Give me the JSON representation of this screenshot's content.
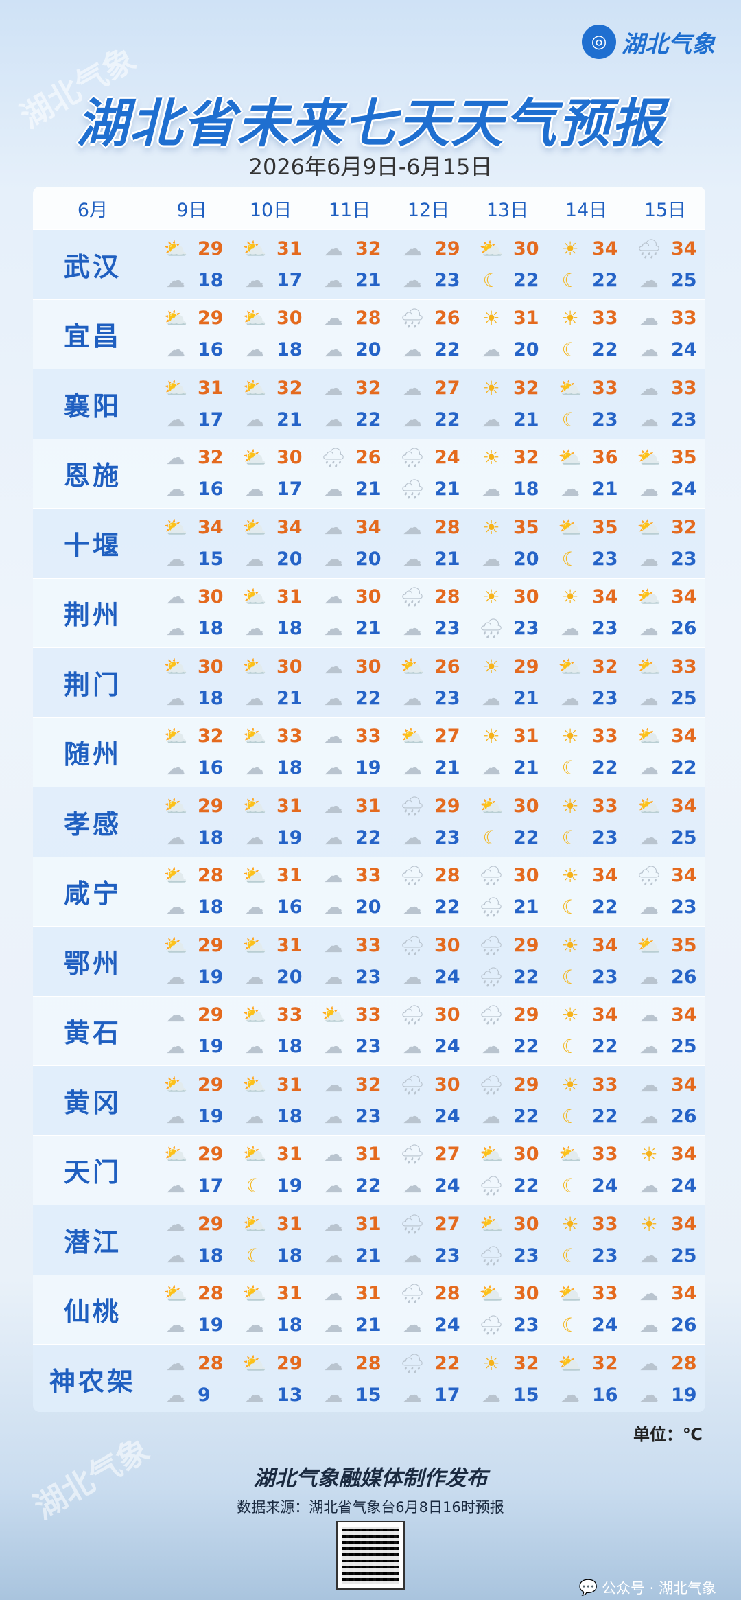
{
  "brand": {
    "name": "湖北气象",
    "logo": "swirl-logo"
  },
  "watermark": "湖北气象",
  "title": "湖北省未来七天天气预报",
  "subtitle": "2026年6月9日-6月15日",
  "table": {
    "month_header": "6月",
    "day_headers": [
      "9日",
      "10日",
      "11日",
      "12日",
      "13日",
      "14日",
      "15日"
    ],
    "rows": [
      {
        "city": "武汉",
        "days": [
          {
            "top": "sun-cloud",
            "hi": "29",
            "bottom": "cloud",
            "lo": "18"
          },
          {
            "top": "sun-cloud",
            "hi": "31",
            "bottom": "moon-cloud",
            "lo": "17"
          },
          {
            "top": "cloud",
            "hi": "32",
            "bottom": "moon-cloud",
            "lo": "21"
          },
          {
            "top": "cloud",
            "hi": "29",
            "bottom": "cloud",
            "lo": "23"
          },
          {
            "top": "sun-cloud",
            "hi": "30",
            "bottom": "moon",
            "lo": "22"
          },
          {
            "top": "sun",
            "hi": "34",
            "bottom": "moon",
            "lo": "22"
          },
          {
            "top": "rain-cloud",
            "hi": "34",
            "bottom": "cloud",
            "lo": "25"
          }
        ]
      },
      {
        "city": "宜昌",
        "days": [
          {
            "top": "sun-cloud",
            "hi": "29",
            "bottom": "moon-cloud",
            "lo": "16"
          },
          {
            "top": "sun-cloud",
            "hi": "30",
            "bottom": "moon-cloud",
            "lo": "18"
          },
          {
            "top": "cloud",
            "hi": "28",
            "bottom": "moon-cloud",
            "lo": "20"
          },
          {
            "top": "rain-cloud",
            "hi": "26",
            "bottom": "cloud",
            "lo": "22"
          },
          {
            "top": "sun",
            "hi": "31",
            "bottom": "moon-cloud",
            "lo": "20"
          },
          {
            "top": "sun",
            "hi": "33",
            "bottom": "moon",
            "lo": "22"
          },
          {
            "top": "cloud",
            "hi": "33",
            "bottom": "moon-cloud",
            "lo": "24"
          }
        ]
      },
      {
        "city": "襄阳",
        "days": [
          {
            "top": "sun-cloud",
            "hi": "31",
            "bottom": "moon-cloud",
            "lo": "17"
          },
          {
            "top": "sun-cloud",
            "hi": "32",
            "bottom": "moon-cloud",
            "lo": "21"
          },
          {
            "top": "cloud",
            "hi": "32",
            "bottom": "moon-cloud",
            "lo": "22"
          },
          {
            "top": "cloud",
            "hi": "27",
            "bottom": "cloud",
            "lo": "22"
          },
          {
            "top": "sun",
            "hi": "32",
            "bottom": "moon-cloud",
            "lo": "21"
          },
          {
            "top": "sun-cloud",
            "hi": "33",
            "bottom": "moon",
            "lo": "23"
          },
          {
            "top": "cloud",
            "hi": "33",
            "bottom": "cloud",
            "lo": "23"
          }
        ]
      },
      {
        "city": "恩施",
        "days": [
          {
            "top": "cloud",
            "hi": "32",
            "bottom": "cloud",
            "lo": "16"
          },
          {
            "top": "sun-cloud",
            "hi": "30",
            "bottom": "moon-cloud",
            "lo": "17"
          },
          {
            "top": "rain-cloud",
            "hi": "26",
            "bottom": "moon-cloud",
            "lo": "21"
          },
          {
            "top": "rain-cloud",
            "hi": "24",
            "bottom": "rain-cloud",
            "lo": "21"
          },
          {
            "top": "sun",
            "hi": "32",
            "bottom": "moon-cloud",
            "lo": "18"
          },
          {
            "top": "sun-cloud",
            "hi": "36",
            "bottom": "moon-cloud",
            "lo": "21"
          },
          {
            "top": "sun-cloud",
            "hi": "35",
            "bottom": "moon-cloud",
            "lo": "24"
          }
        ]
      },
      {
        "city": "十堰",
        "days": [
          {
            "top": "sun-cloud",
            "hi": "34",
            "bottom": "moon-cloud",
            "lo": "15"
          },
          {
            "top": "sun-cloud",
            "hi": "34",
            "bottom": "moon-cloud",
            "lo": "20"
          },
          {
            "top": "cloud",
            "hi": "34",
            "bottom": "moon-cloud",
            "lo": "20"
          },
          {
            "top": "cloud",
            "hi": "28",
            "bottom": "cloud",
            "lo": "21"
          },
          {
            "top": "sun",
            "hi": "35",
            "bottom": "moon-cloud",
            "lo": "20"
          },
          {
            "top": "sun-cloud",
            "hi": "35",
            "bottom": "moon",
            "lo": "23"
          },
          {
            "top": "sun-cloud",
            "hi": "32",
            "bottom": "cloud",
            "lo": "23"
          }
        ]
      },
      {
        "city": "荆州",
        "days": [
          {
            "top": "cloud",
            "hi": "30",
            "bottom": "moon-cloud",
            "lo": "18"
          },
          {
            "top": "sun-cloud",
            "hi": "31",
            "bottom": "moon-cloud",
            "lo": "18"
          },
          {
            "top": "cloud",
            "hi": "30",
            "bottom": "moon-cloud",
            "lo": "21"
          },
          {
            "top": "rain-cloud",
            "hi": "28",
            "bottom": "cloud",
            "lo": "23"
          },
          {
            "top": "sun",
            "hi": "30",
            "bottom": "rain-cloud",
            "lo": "23"
          },
          {
            "top": "sun",
            "hi": "34",
            "bottom": "moon-cloud",
            "lo": "23"
          },
          {
            "top": "sun-cloud",
            "hi": "34",
            "bottom": "moon-cloud",
            "lo": "26"
          }
        ]
      },
      {
        "city": "荆门",
        "days": [
          {
            "top": "sun-cloud",
            "hi": "30",
            "bottom": "moon-cloud",
            "lo": "18"
          },
          {
            "top": "sun-cloud",
            "hi": "30",
            "bottom": "moon-cloud",
            "lo": "21"
          },
          {
            "top": "cloud",
            "hi": "30",
            "bottom": "moon-cloud",
            "lo": "22"
          },
          {
            "top": "sun-cloud",
            "hi": "26",
            "bottom": "cloud",
            "lo": "23"
          },
          {
            "top": "sun",
            "hi": "29",
            "bottom": "moon-cloud",
            "lo": "21"
          },
          {
            "top": "sun-cloud",
            "hi": "32",
            "bottom": "moon-cloud",
            "lo": "23"
          },
          {
            "top": "sun-cloud",
            "hi": "33",
            "bottom": "moon-cloud",
            "lo": "25"
          }
        ]
      },
      {
        "city": "随州",
        "days": [
          {
            "top": "sun-cloud",
            "hi": "32",
            "bottom": "moon-cloud",
            "lo": "16"
          },
          {
            "top": "sun-cloud",
            "hi": "33",
            "bottom": "moon-cloud",
            "lo": "18"
          },
          {
            "top": "cloud",
            "hi": "33",
            "bottom": "moon-cloud",
            "lo": "19"
          },
          {
            "top": "sun-cloud",
            "hi": "27",
            "bottom": "cloud",
            "lo": "21"
          },
          {
            "top": "sun",
            "hi": "31",
            "bottom": "moon-cloud",
            "lo": "21"
          },
          {
            "top": "sun",
            "hi": "33",
            "bottom": "moon",
            "lo": "22"
          },
          {
            "top": "sun-cloud",
            "hi": "34",
            "bottom": "cloud",
            "lo": "22"
          }
        ]
      },
      {
        "city": "孝感",
        "days": [
          {
            "top": "sun-cloud",
            "hi": "29",
            "bottom": "cloud",
            "lo": "18"
          },
          {
            "top": "sun-cloud",
            "hi": "31",
            "bottom": "moon-cloud",
            "lo": "19"
          },
          {
            "top": "cloud",
            "hi": "31",
            "bottom": "moon-cloud",
            "lo": "22"
          },
          {
            "top": "rain-cloud",
            "hi": "29",
            "bottom": "cloud",
            "lo": "23"
          },
          {
            "top": "sun-cloud",
            "hi": "30",
            "bottom": "moon",
            "lo": "22"
          },
          {
            "top": "sun",
            "hi": "33",
            "bottom": "moon",
            "lo": "23"
          },
          {
            "top": "sun-cloud",
            "hi": "34",
            "bottom": "cloud",
            "lo": "25"
          }
        ]
      },
      {
        "city": "咸宁",
        "days": [
          {
            "top": "sun-cloud",
            "hi": "28",
            "bottom": "cloud",
            "lo": "18"
          },
          {
            "top": "sun-cloud",
            "hi": "31",
            "bottom": "moon-cloud",
            "lo": "16"
          },
          {
            "top": "cloud",
            "hi": "33",
            "bottom": "moon-cloud",
            "lo": "20"
          },
          {
            "top": "rain-cloud",
            "hi": "28",
            "bottom": "cloud",
            "lo": "22"
          },
          {
            "top": "rain-cloud",
            "hi": "30",
            "bottom": "rain-cloud",
            "lo": "21"
          },
          {
            "top": "sun",
            "hi": "34",
            "bottom": "moon",
            "lo": "22"
          },
          {
            "top": "rain-cloud",
            "hi": "34",
            "bottom": "cloud",
            "lo": "23"
          }
        ]
      },
      {
        "city": "鄂州",
        "days": [
          {
            "top": "sun-cloud",
            "hi": "29",
            "bottom": "cloud",
            "lo": "19"
          },
          {
            "top": "sun-cloud",
            "hi": "31",
            "bottom": "moon-cloud",
            "lo": "20"
          },
          {
            "top": "cloud",
            "hi": "33",
            "bottom": "moon-cloud",
            "lo": "23"
          },
          {
            "top": "rain-cloud",
            "hi": "30",
            "bottom": "cloud",
            "lo": "24"
          },
          {
            "top": "rain-cloud",
            "hi": "29",
            "bottom": "rain-cloud",
            "lo": "22"
          },
          {
            "top": "sun",
            "hi": "34",
            "bottom": "moon",
            "lo": "23"
          },
          {
            "top": "sun-cloud",
            "hi": "35",
            "bottom": "cloud",
            "lo": "26"
          }
        ]
      },
      {
        "city": "黄石",
        "days": [
          {
            "top": "cloud",
            "hi": "29",
            "bottom": "cloud",
            "lo": "19"
          },
          {
            "top": "sun-cloud",
            "hi": "33",
            "bottom": "moon-cloud",
            "lo": "18"
          },
          {
            "top": "sun-cloud",
            "hi": "33",
            "bottom": "moon-cloud",
            "lo": "23"
          },
          {
            "top": "rain-cloud",
            "hi": "30",
            "bottom": "cloud",
            "lo": "24"
          },
          {
            "top": "rain-cloud",
            "hi": "29",
            "bottom": "moon-cloud",
            "lo": "22"
          },
          {
            "top": "sun",
            "hi": "34",
            "bottom": "moon",
            "lo": "22"
          },
          {
            "top": "cloud",
            "hi": "34",
            "bottom": "moon-cloud",
            "lo": "25"
          }
        ]
      },
      {
        "city": "黄冈",
        "days": [
          {
            "top": "sun-cloud",
            "hi": "29",
            "bottom": "cloud",
            "lo": "19"
          },
          {
            "top": "sun-cloud",
            "hi": "31",
            "bottom": "moon-cloud",
            "lo": "18"
          },
          {
            "top": "cloud",
            "hi": "32",
            "bottom": "moon-cloud",
            "lo": "23"
          },
          {
            "top": "rain-cloud",
            "hi": "30",
            "bottom": "cloud",
            "lo": "24"
          },
          {
            "top": "rain-cloud",
            "hi": "29",
            "bottom": "moon-cloud",
            "lo": "22"
          },
          {
            "top": "sun",
            "hi": "33",
            "bottom": "moon",
            "lo": "22"
          },
          {
            "top": "cloud",
            "hi": "34",
            "bottom": "cloud",
            "lo": "26"
          }
        ]
      },
      {
        "city": "天门",
        "days": [
          {
            "top": "sun-cloud",
            "hi": "29",
            "bottom": "moon-cloud",
            "lo": "17"
          },
          {
            "top": "sun-cloud",
            "hi": "31",
            "bottom": "moon",
            "lo": "19"
          },
          {
            "top": "cloud",
            "hi": "31",
            "bottom": "moon-cloud",
            "lo": "22"
          },
          {
            "top": "rain-cloud",
            "hi": "27",
            "bottom": "cloud",
            "lo": "24"
          },
          {
            "top": "sun-cloud",
            "hi": "30",
            "bottom": "rain-cloud",
            "lo": "22"
          },
          {
            "top": "sun-cloud",
            "hi": "33",
            "bottom": "moon",
            "lo": "24"
          },
          {
            "top": "sun",
            "hi": "34",
            "bottom": "moon-cloud",
            "lo": "24"
          }
        ]
      },
      {
        "city": "潜江",
        "days": [
          {
            "top": "cloud",
            "hi": "29",
            "bottom": "cloud",
            "lo": "18"
          },
          {
            "top": "sun-cloud",
            "hi": "31",
            "bottom": "moon",
            "lo": "18"
          },
          {
            "top": "cloud",
            "hi": "31",
            "bottom": "moon-cloud",
            "lo": "21"
          },
          {
            "top": "rain-cloud",
            "hi": "27",
            "bottom": "cloud",
            "lo": "23"
          },
          {
            "top": "sun-cloud",
            "hi": "30",
            "bottom": "rain-cloud",
            "lo": "23"
          },
          {
            "top": "sun",
            "hi": "33",
            "bottom": "moon",
            "lo": "23"
          },
          {
            "top": "sun",
            "hi": "34",
            "bottom": "cloud",
            "lo": "25"
          }
        ]
      },
      {
        "city": "仙桃",
        "days": [
          {
            "top": "sun-cloud",
            "hi": "28",
            "bottom": "cloud",
            "lo": "19"
          },
          {
            "top": "sun-cloud",
            "hi": "31",
            "bottom": "moon-cloud",
            "lo": "18"
          },
          {
            "top": "cloud",
            "hi": "31",
            "bottom": "moon-cloud",
            "lo": "21"
          },
          {
            "top": "rain-cloud",
            "hi": "28",
            "bottom": "cloud",
            "lo": "24"
          },
          {
            "top": "sun-cloud",
            "hi": "30",
            "bottom": "rain-cloud",
            "lo": "23"
          },
          {
            "top": "sun-cloud",
            "hi": "33",
            "bottom": "moon",
            "lo": "24"
          },
          {
            "top": "cloud",
            "hi": "34",
            "bottom": "cloud",
            "lo": "26"
          }
        ]
      },
      {
        "city": "神农架",
        "days": [
          {
            "top": "cloud",
            "hi": "28",
            "bottom": "moon-cloud",
            "lo": "9"
          },
          {
            "top": "sun-cloud",
            "hi": "29",
            "bottom": "moon-cloud",
            "lo": "13"
          },
          {
            "top": "cloud",
            "hi": "28",
            "bottom": "moon-cloud",
            "lo": "15"
          },
          {
            "top": "rain-cloud",
            "hi": "22",
            "bottom": "cloud",
            "lo": "17"
          },
          {
            "top": "sun",
            "hi": "32",
            "bottom": "moon-cloud",
            "lo": "15"
          },
          {
            "top": "sun-cloud",
            "hi": "32",
            "bottom": "moon-cloud",
            "lo": "16"
          },
          {
            "top": "cloud",
            "hi": "28",
            "bottom": "moon-cloud",
            "lo": "19"
          }
        ]
      }
    ]
  },
  "unit": "单位：℃",
  "footer": {
    "title": "湖北气象融媒体制作发布",
    "source": "数据来源：湖北省气象台6月8日16时预报"
  },
  "wechat": {
    "label": "公众号 · 湖北气象"
  },
  "colors": {
    "title": "#1f6fd0",
    "high_temp": "#e46a1e",
    "low_temp": "#2563c7",
    "city": "#1f5fc0"
  }
}
